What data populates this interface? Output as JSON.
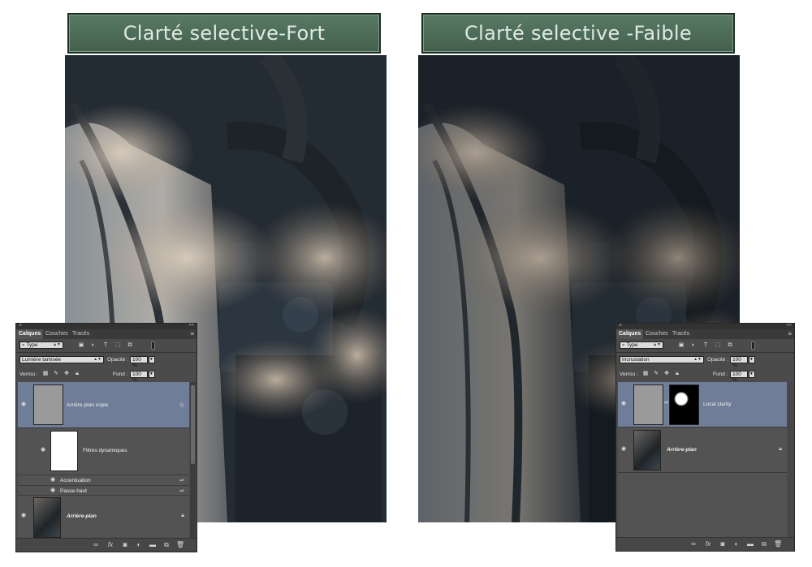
{
  "banners": {
    "left": "Clarté selective-Fort",
    "right": "Clarté selective -Faible"
  },
  "panel_left": {
    "tabs": [
      "Calques",
      "Couches",
      "Tracés"
    ],
    "filter_kind": "Type",
    "blend_mode": "Lumière tamisée",
    "opacity_label": "Opacité :",
    "opacity_value": "100 %",
    "lock_label": "Verrou :",
    "fill_label": "Fond :",
    "fill_value": "100 %",
    "layers": [
      {
        "name": "Arrière-plan copie",
        "selected": true
      },
      {
        "name": "Filtres dynamiques"
      },
      {
        "name": "Accentuation"
      },
      {
        "name": "Passe-haut"
      },
      {
        "name": "Arrière-plan",
        "locked": true
      }
    ]
  },
  "panel_right": {
    "tabs": [
      "Calques",
      "Couches",
      "Tracés"
    ],
    "filter_kind": "Type",
    "blend_mode": "Incrustation",
    "opacity_label": "Opacité :",
    "opacity_value": "100 %",
    "lock_label": "Verrou :",
    "fill_label": "Fond :",
    "fill_value": "100 %",
    "layers": [
      {
        "name": "Local clarity",
        "selected": true
      },
      {
        "name": "Arrière-plan",
        "locked": true
      }
    ]
  },
  "icons": {
    "eye": "eye-icon",
    "lock": "lock-icon",
    "search": "search-icon",
    "link": "link-icon",
    "fx": "fx-icon",
    "mask": "mask-icon",
    "adjustment": "adjustment-icon",
    "folder": "folder-icon",
    "new_layer": "new-layer-icon",
    "trash": "trash-icon"
  },
  "colors": {
    "banner_bg": "#4d6c58",
    "panel_bg": "#4b4b4b",
    "selected_layer": "#6f7d99"
  }
}
